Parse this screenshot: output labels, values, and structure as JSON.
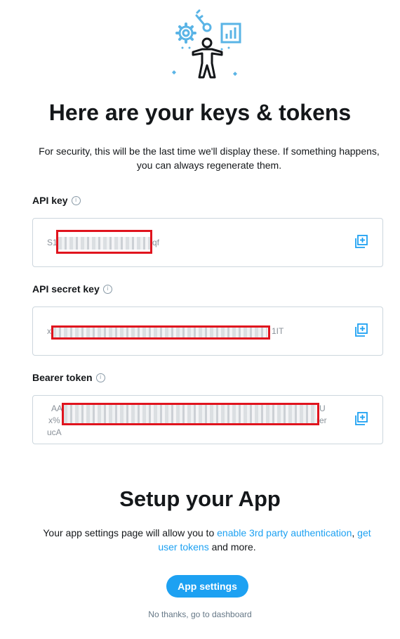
{
  "header": {
    "title": "Here are your keys & tokens",
    "subtitle_line1": "For security, this will be the last time we'll display these. If something happens,",
    "subtitle_line2": "you can always regenerate them."
  },
  "fields": [
    {
      "label": "API key",
      "prefix": "S1",
      "suffix": "qf",
      "copy_icon": "copy-icon"
    },
    {
      "label": "API secret key",
      "prefix": "x",
      "suffix": "1IT",
      "copy_icon": "copy-icon"
    },
    {
      "label": "Bearer token",
      "line1_prefix": "AA",
      "line1_suffix": "U",
      "line2_prefix": "x%",
      "line2_suffix": "rer",
      "line3": "ucA",
      "copy_icon": "copy-icon"
    }
  ],
  "setup": {
    "title": "Setup your App",
    "text_before": "Your app settings page will allow you to ",
    "link1": "enable 3rd party authentication",
    "text_between": ", ",
    "link2": "get user tokens",
    "text_after": " and more.",
    "button_label": "App settings",
    "dashboard_link": "No thanks, go to dashboard"
  },
  "colors": {
    "accent": "#1da1f2",
    "redaction": "#e0141e",
    "illustration_blue": "#5ab4e6"
  }
}
